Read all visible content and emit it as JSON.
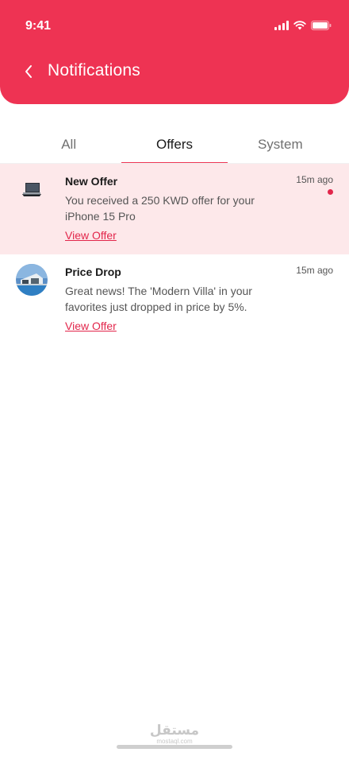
{
  "status_bar": {
    "time": "9:41"
  },
  "header": {
    "title": "Notifications"
  },
  "tabs": [
    {
      "label": "All",
      "active": false
    },
    {
      "label": "Offers",
      "active": true
    },
    {
      "label": "System",
      "active": false
    }
  ],
  "notifications": [
    {
      "title": "New Offer",
      "body": "You received a 250 KWD offer for your iPhone 15 Pro",
      "link": "View Offer",
      "time": "15m ago",
      "unread": true,
      "image": "laptop-thumbnail"
    },
    {
      "title": "Price Drop",
      "body": "Great news! The 'Modern Villa' in your favorites just dropped in price by 5%.",
      "link": "View Offer",
      "time": "15m ago",
      "unread": false,
      "image": "villa-thumbnail"
    }
  ],
  "watermark": {
    "arabic": "مستقل",
    "latin": "mostaql.com"
  },
  "colors": {
    "accent": "#ee3353",
    "unread_bg": "#fde8ea",
    "link": "#e2264b"
  }
}
